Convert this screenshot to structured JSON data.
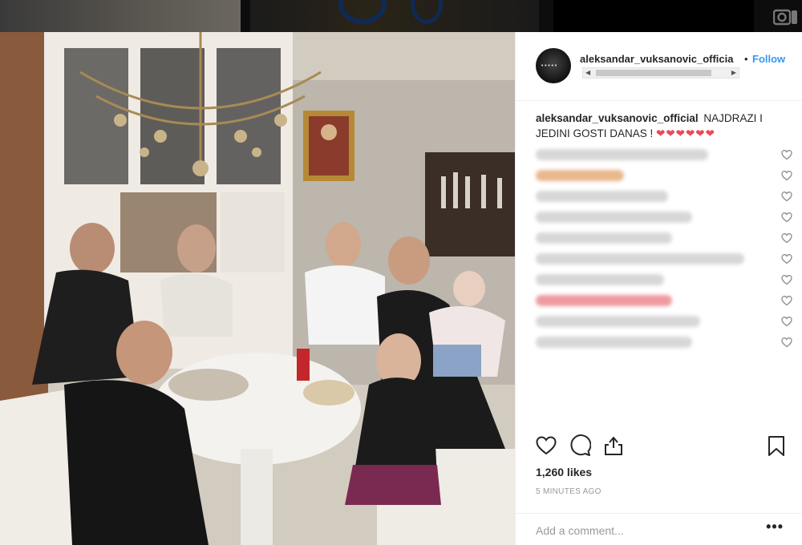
{
  "post": {
    "username": "aleksandar_vuksanovic_officia",
    "separator": "•",
    "follow_label": "Follow",
    "caption_user": "aleksandar_vuksanovic_official",
    "caption_text": "NAJDRAZI I JEDINI GOSTI DANAS !",
    "caption_hearts": "❤❤❤❤❤❤",
    "likes": "1,260 likes",
    "timestamp": "5 MINUTES AGO",
    "add_comment_placeholder": "Add a comment...",
    "more_label": "•••"
  },
  "comments": [
    {
      "style": "gray",
      "width": 215
    },
    {
      "style": "orange",
      "width": 110
    },
    {
      "style": "gray",
      "width": 165
    },
    {
      "style": "gray",
      "width": 195
    },
    {
      "style": "gray",
      "width": 170
    },
    {
      "style": "gray",
      "width": 260
    },
    {
      "style": "gray",
      "width": 160
    },
    {
      "style": "red",
      "width": 170
    },
    {
      "style": "gray",
      "width": 205
    },
    {
      "style": "gray",
      "width": 195
    }
  ],
  "colors": {
    "follow": "#3897f0",
    "heart": "#ed4956",
    "text": "#262626",
    "muted": "#999999"
  },
  "icons": [
    "camera-icon",
    "heart-icon",
    "comment-icon",
    "share-icon",
    "bookmark-icon"
  ]
}
